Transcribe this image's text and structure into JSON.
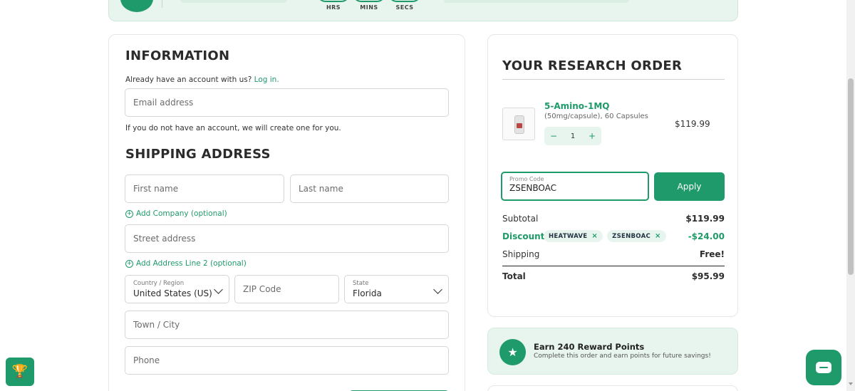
{
  "countdown": {
    "units": [
      "HRS",
      "MINS",
      "SECS"
    ]
  },
  "information": {
    "heading": "INFORMATION",
    "account_prompt": "Already have an account with us?",
    "login_link": "Log in.",
    "email_placeholder": "Email address",
    "account_note": "If you do not have an account, we will create one for you."
  },
  "shipping": {
    "heading": "SHIPPING ADDRESS",
    "first_name_placeholder": "First name",
    "last_name_placeholder": "Last name",
    "add_company": "Add Company (optional)",
    "street_placeholder": "Street address",
    "add_address_line2": "Add Address Line 2 (optional)",
    "country_label": "Country / Region",
    "country_value": "United States (US)",
    "zip_placeholder": "ZIP Code",
    "state_label": "State",
    "state_value": "Florida",
    "town_placeholder": "Town / City",
    "phone_placeholder": "Phone"
  },
  "order": {
    "heading": "YOUR RESEARCH ORDER",
    "product": {
      "name": "5-Amino-1MQ",
      "description": "(50mg/capsule), 60 Capsules",
      "quantity": "1",
      "price": "$119.99"
    },
    "promo_label": "Promo Code",
    "promo_value": "ZSENBOAC",
    "apply_label": "Apply",
    "subtotal_label": "Subtotal",
    "subtotal_value": "$119.99",
    "discount_label": "Discount",
    "discount_tags": [
      "HEATWAVE",
      "ZSENBOAC"
    ],
    "discount_value": "-$24.00",
    "shipping_label": "Shipping",
    "shipping_value": "Free!",
    "total_label": "Total",
    "total_value": "$95.99"
  },
  "reward": {
    "title": "Earn 240 Reward Points",
    "subtitle": "Complete this order and earn points for future savings!"
  },
  "colors": {
    "accent": "#1f9a6a",
    "accent_light": "#e8f5ee"
  },
  "icons": {
    "truck": "truck-icon",
    "star": "star-icon",
    "trophy": "trophy-icon",
    "chat": "chat-icon"
  }
}
